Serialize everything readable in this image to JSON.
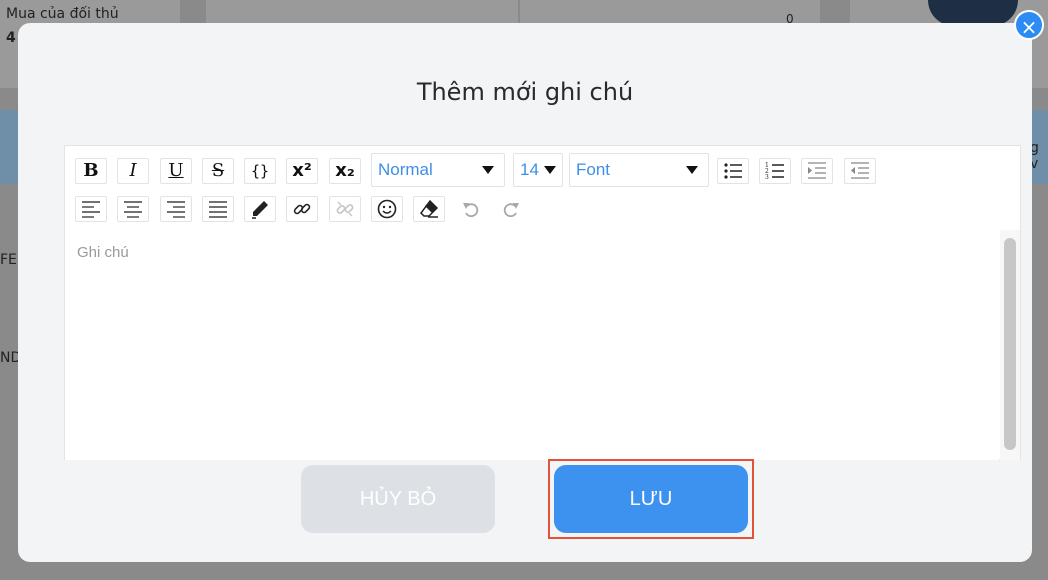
{
  "background": {
    "card_title": "Mua của đối thủ",
    "card_value": "4",
    "side_text_1": "FE",
    "side_text_2": "ND",
    "side_text_right": "g v",
    "counter": "0"
  },
  "modal": {
    "title": "Thêm mới ghi chú",
    "close_icon": "×"
  },
  "toolbar": {
    "bold": "B",
    "italic": "I",
    "underline": "U",
    "strike": "S",
    "code": "{}",
    "superscript": "x²",
    "subscript": "x₂",
    "style_select": "Normal",
    "size_select": "14",
    "font_select": "Font"
  },
  "editor": {
    "placeholder": "Ghi chú"
  },
  "actions": {
    "cancel_label": "HỦY BỎ",
    "save_label": "LƯU"
  },
  "colors": {
    "accent": "#3d91ef",
    "highlight": "#e0533a"
  }
}
